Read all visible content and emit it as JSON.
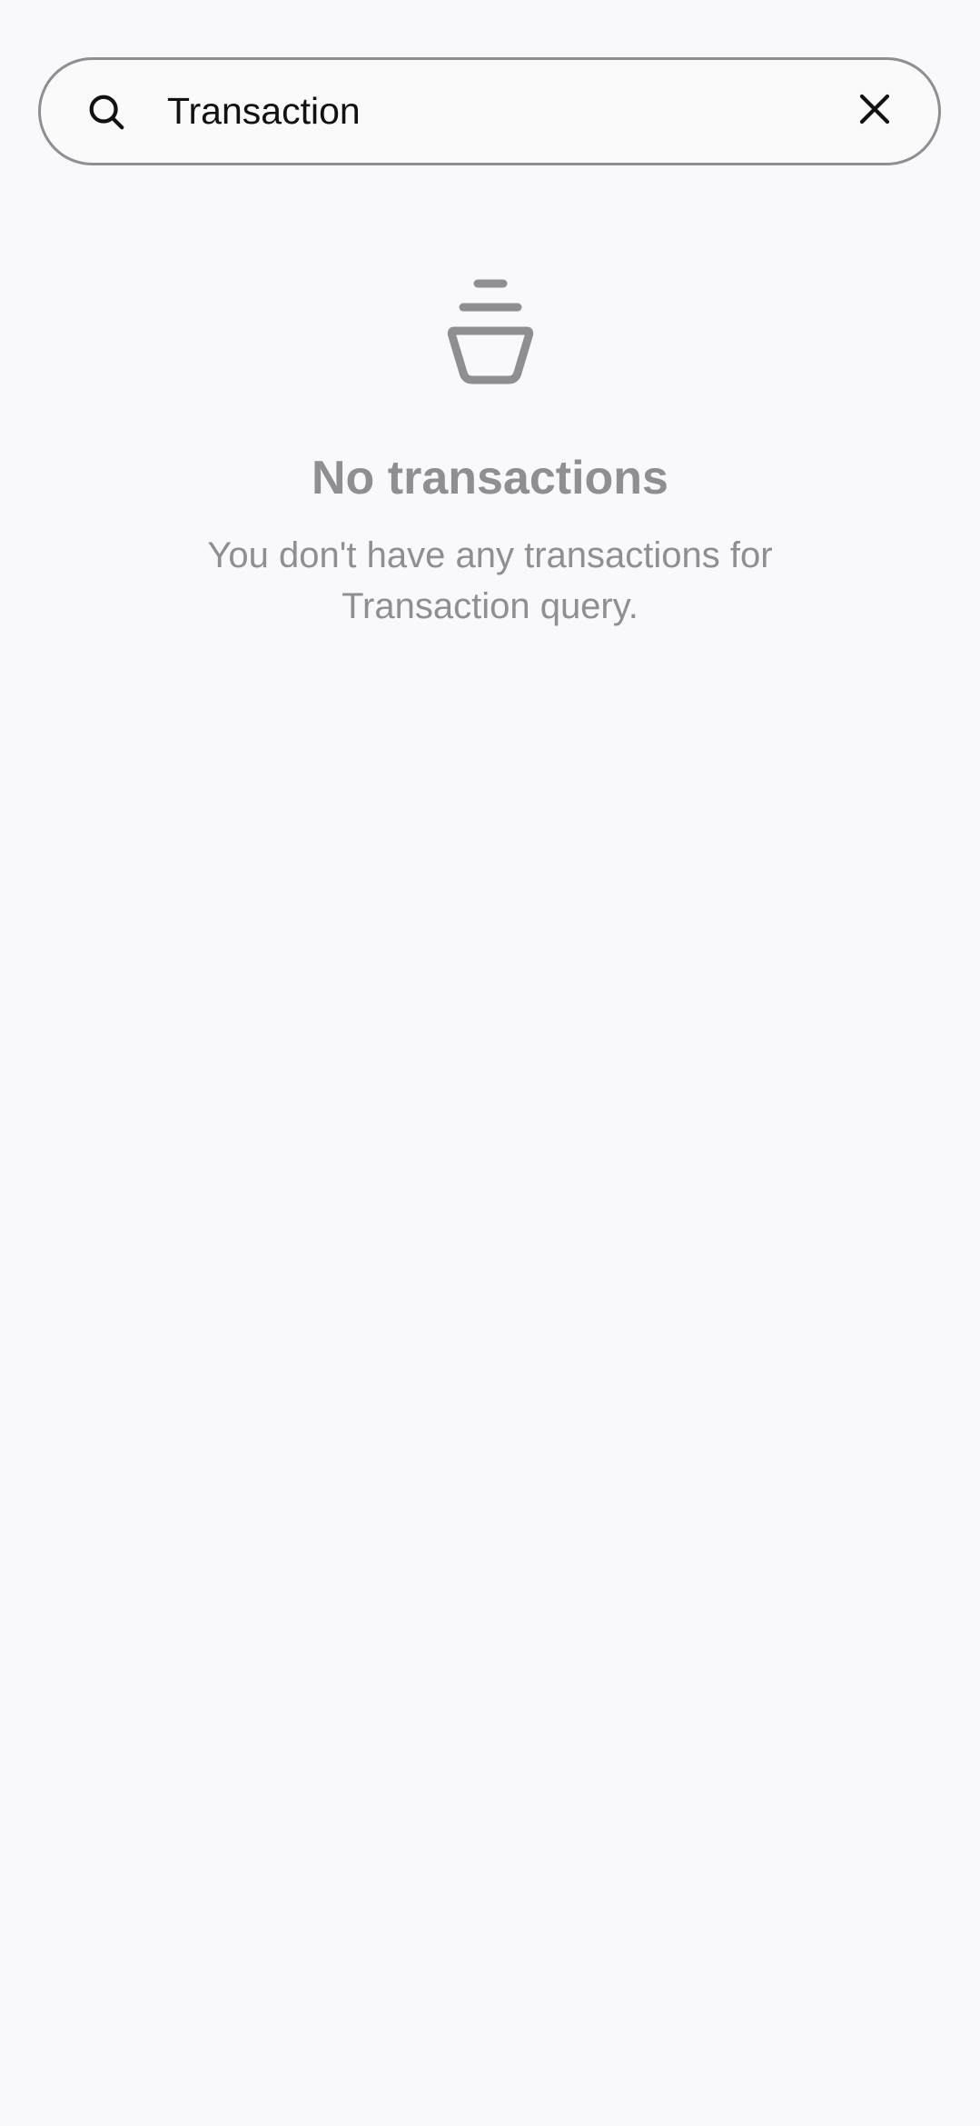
{
  "search": {
    "value": "Transaction",
    "icon": "search-icon",
    "clear_icon": "close-icon"
  },
  "empty_state": {
    "icon": "empty-basket-icon",
    "title": "No transactions",
    "message": "You don't have any transactions for Transaction query."
  },
  "colors": {
    "background": "#f9f9fb",
    "muted_text": "#8e8e93",
    "primary_text": "#111111",
    "border": "#8e8e93"
  }
}
